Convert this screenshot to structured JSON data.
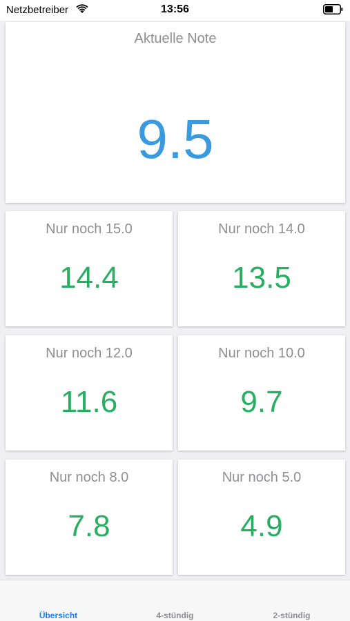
{
  "status_bar": {
    "carrier": "Netzbetreiber",
    "time": "13:56",
    "wifi_icon": "wifi-icon",
    "battery_icon": "battery-icon"
  },
  "current_grade": {
    "label": "Aktuelle Note",
    "value": "9.5",
    "color": "#3a9ae0"
  },
  "targets": [
    {
      "label": "Nur noch 15.0",
      "value": "14.4"
    },
    {
      "label": "Nur noch 14.0",
      "value": "13.5"
    },
    {
      "label": "Nur noch 12.0",
      "value": "11.6"
    },
    {
      "label": "Nur noch 10.0",
      "value": "9.7"
    },
    {
      "label": "Nur noch 8.0",
      "value": "7.8"
    },
    {
      "label": "Nur noch 5.0",
      "value": "4.9"
    }
  ],
  "target_color": "#27ae60",
  "tabs": [
    {
      "label": "Übersicht",
      "active": true
    },
    {
      "label": "4-stündig",
      "active": false
    },
    {
      "label": "2-stündig",
      "active": false
    }
  ],
  "accent_color": "#1a7ff0"
}
